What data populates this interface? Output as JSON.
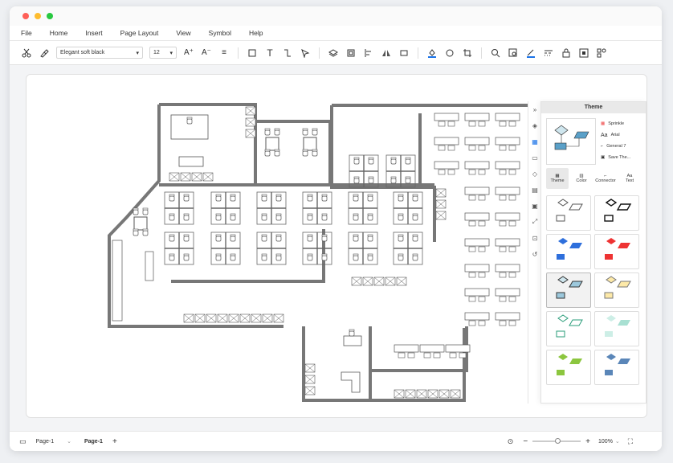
{
  "menu": [
    "File",
    "Home",
    "Insert",
    "Page Layout",
    "View",
    "Symbol",
    "Help"
  ],
  "toolbar": {
    "font_name": "Elegant soft black",
    "font_size": "12"
  },
  "panel": {
    "title": "Theme",
    "options": [
      "Sprinkle",
      "Arial",
      "General 7",
      "Save The..."
    ],
    "tabs": [
      "Theme",
      "Color",
      "Connector",
      "Text"
    ]
  },
  "status": {
    "page_selector": "Page-1",
    "page_tab": "Page-1",
    "zoom": "100%"
  },
  "colors": {
    "wall": "#777777",
    "accent": "#1a73e8"
  }
}
